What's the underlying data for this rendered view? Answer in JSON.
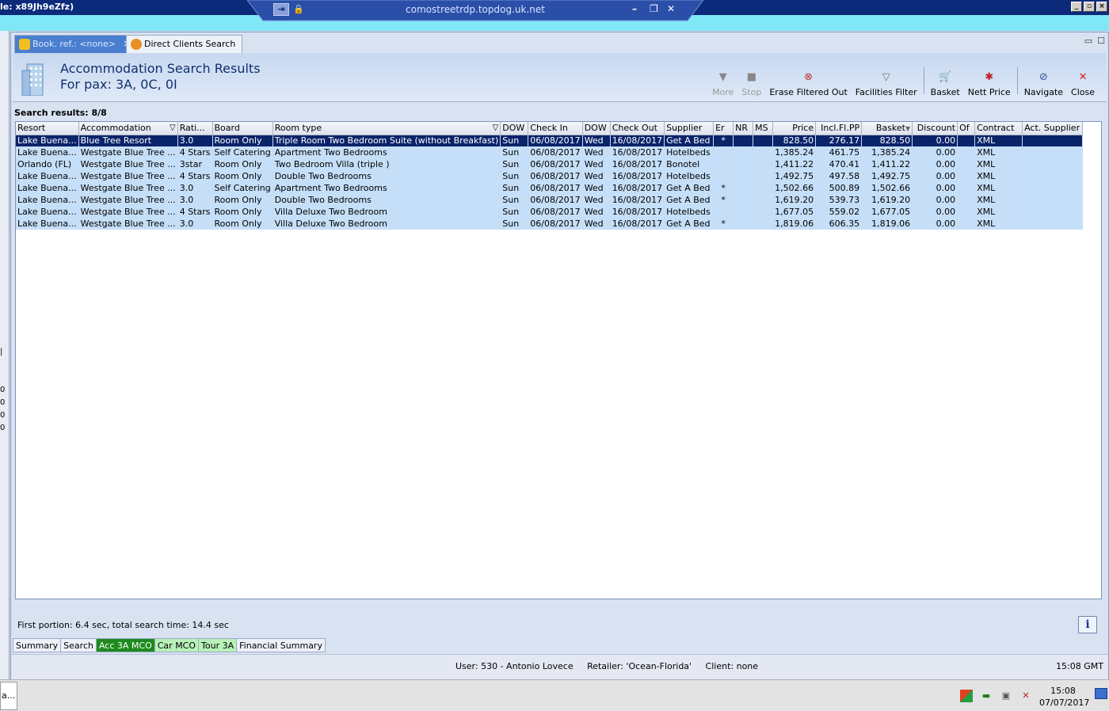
{
  "window": {
    "title": "le: x89Jh9eZfz)",
    "rdp_host": "comostreetrdp.topdog.uk.net"
  },
  "tabs": [
    {
      "label": "Book. ref.: <none>",
      "icon": "palm-tree-icon",
      "active": true
    },
    {
      "label": "Direct Clients Search",
      "icon": "star-icon",
      "active": false
    }
  ],
  "header": {
    "title": "Accommodation Search Results",
    "subtitle": "For pax: 3A, 0C, 0I",
    "icon": "hotel-building-icon"
  },
  "toolbar": [
    {
      "label": "More",
      "icon": "triangle-down-icon",
      "enabled": false
    },
    {
      "label": "Stop",
      "icon": "stop-icon",
      "enabled": false
    },
    {
      "label": "Erase Filtered Out",
      "icon": "erase-filter-icon",
      "enabled": true
    },
    {
      "label": "Facilities Filter",
      "icon": "funnel-icon",
      "enabled": true
    },
    {
      "label": "Basket",
      "icon": "basket-icon",
      "enabled": true
    },
    {
      "label": "Nett Price",
      "icon": "nett-price-icon",
      "enabled": true
    },
    {
      "label": "Navigate",
      "icon": "navigate-icon",
      "enabled": true
    },
    {
      "label": "Close",
      "icon": "close-icon",
      "enabled": true
    }
  ],
  "results_label": "Search results: 8/8",
  "grid": {
    "columns": [
      "Resort",
      "Accommodation",
      "Rati...",
      "Board",
      "Room type",
      "DOW",
      "Check In",
      "DOW",
      "Check Out",
      "Supplier",
      "Er",
      "NR",
      "MS",
      "Price",
      "Incl.Fl.PP",
      "Basket",
      "Discount",
      "Of",
      "Contract",
      "Act. Supplier"
    ],
    "rows": [
      [
        "Lake Buena...",
        "Blue Tree Resort",
        "3.0",
        "Room Only",
        "Triple Room Two Bedroom Suite (without Breakfast)",
        "Sun",
        "06/08/2017",
        "Wed",
        "16/08/2017",
        "Get A Bed",
        "*",
        "",
        "",
        "828.50",
        "276.17",
        "828.50",
        "0.00",
        "",
        "XML",
        ""
      ],
      [
        "Lake Buena...",
        "Westgate Blue Tree ...",
        "4 Stars",
        "Self Catering",
        "Apartment Two Bedrooms",
        "Sun",
        "06/08/2017",
        "Wed",
        "16/08/2017",
        "Hotelbeds",
        "",
        "",
        "",
        "1,385.24",
        "461.75",
        "1,385.24",
        "0.00",
        "",
        "XML",
        ""
      ],
      [
        "Orlando (FL)",
        "Westgate Blue Tree ...",
        "3star",
        "Room Only",
        "Two Bedroom Villa (triple )",
        "Sun",
        "06/08/2017",
        "Wed",
        "16/08/2017",
        "Bonotel",
        "",
        "",
        "",
        "1,411.22",
        "470.41",
        "1,411.22",
        "0.00",
        "",
        "XML",
        ""
      ],
      [
        "Lake Buena...",
        "Westgate Blue Tree ...",
        "4 Stars",
        "Room Only",
        "Double Two Bedrooms",
        "Sun",
        "06/08/2017",
        "Wed",
        "16/08/2017",
        "Hotelbeds",
        "",
        "",
        "",
        "1,492.75",
        "497.58",
        "1,492.75",
        "0.00",
        "",
        "XML",
        ""
      ],
      [
        "Lake Buena...",
        "Westgate Blue Tree ...",
        "3.0",
        "Self Catering",
        "Apartment Two Bedrooms",
        "Sun",
        "06/08/2017",
        "Wed",
        "16/08/2017",
        "Get A Bed",
        "*",
        "",
        "",
        "1,502.66",
        "500.89",
        "1,502.66",
        "0.00",
        "",
        "XML",
        ""
      ],
      [
        "Lake Buena...",
        "Westgate Blue Tree ...",
        "3.0",
        "Room Only",
        "Double Two Bedrooms",
        "Sun",
        "06/08/2017",
        "Wed",
        "16/08/2017",
        "Get A Bed",
        "*",
        "",
        "",
        "1,619.20",
        "539.73",
        "1,619.20",
        "0.00",
        "",
        "XML",
        ""
      ],
      [
        "Lake Buena...",
        "Westgate Blue Tree ...",
        "4 Stars",
        "Room Only",
        "Villa Deluxe Two Bedroom",
        "Sun",
        "06/08/2017",
        "Wed",
        "16/08/2017",
        "Hotelbeds",
        "",
        "",
        "",
        "1,677.05",
        "559.02",
        "1,677.05",
        "0.00",
        "",
        "XML",
        ""
      ],
      [
        "Lake Buena...",
        "Westgate Blue Tree ...",
        "3.0",
        "Room Only",
        "Villa Deluxe Two Bedroom",
        "Sun",
        "06/08/2017",
        "Wed",
        "16/08/2017",
        "Get A Bed",
        "*",
        "",
        "",
        "1,819.06",
        "606.35",
        "1,819.06",
        "0.00",
        "",
        "XML",
        ""
      ]
    ],
    "selected_row": 0
  },
  "status_text": "First portion: 6.4 sec, total search time: 14.4 sec",
  "bottom_tabs": [
    {
      "label": "Summary",
      "style": "plain"
    },
    {
      "label": "Search",
      "style": "plain"
    },
    {
      "label": "Acc 3A MCO",
      "style": "green"
    },
    {
      "label": "Car MCO",
      "style": "lightgreen"
    },
    {
      "label": "Tour 3A",
      "style": "lightgreen"
    },
    {
      "label": "Financial Summary",
      "style": "plain"
    }
  ],
  "info_bar": {
    "user_text": "User: 530 - Antonio Lovece     Retailer: 'Ocean-Florida'     Client: none",
    "gmt_time": "15:08 GMT"
  },
  "taskbar": {
    "app_label": "a...",
    "time": "15:08",
    "date": "07/07/2017"
  },
  "colors": {
    "selected_row": "#0a246a",
    "row_bg": "#c6dff8",
    "accent_green": "#1e8a1e"
  }
}
